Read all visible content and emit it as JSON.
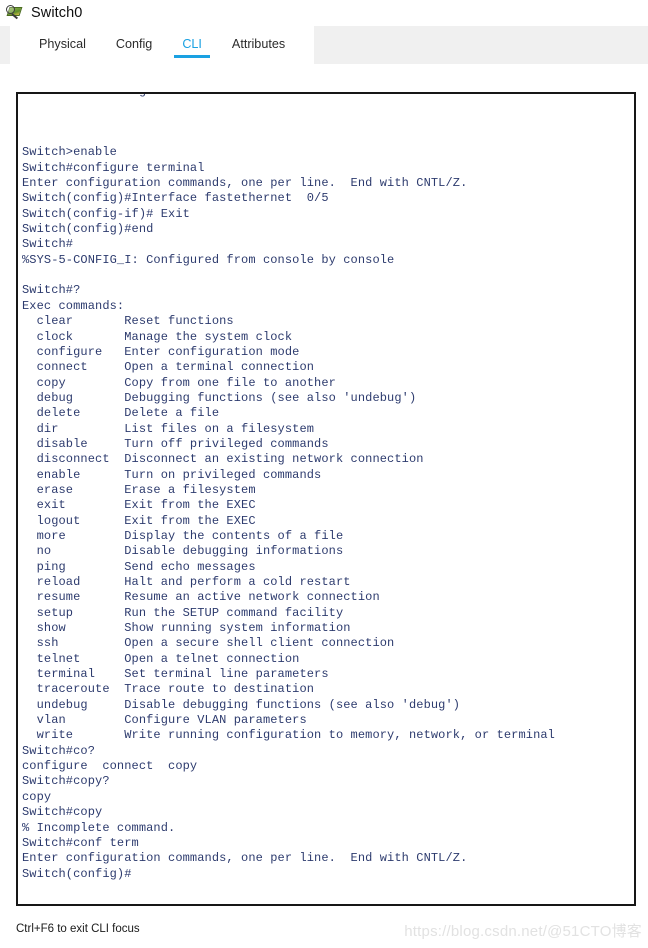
{
  "window": {
    "title": "Switch0",
    "icon": "switch-device-icon"
  },
  "tabs": [
    {
      "label": "Physical",
      "active": false
    },
    {
      "label": "Config",
      "active": false
    },
    {
      "label": "CLI",
      "active": true
    },
    {
      "label": "Attributes",
      "active": false
    }
  ],
  "colors": {
    "accent": "#1aa1e2",
    "terminal_text": "#2d3b6e",
    "terminal_border": "#171717",
    "tabstrip_bg": "#f0f0f0",
    "watermark": "#e2e2e2"
  },
  "terminal": {
    "lines": [
      "Press RETURN to get started!",
      "",
      "",
      "",
      "Switch>enable",
      "Switch#configure terminal",
      "Enter configuration commands, one per line.  End with CNTL/Z.",
      "Switch(config)#Interface fastethernet  0/5",
      "Switch(config-if)# Exit",
      "Switch(config)#end",
      "Switch#",
      "%SYS-5-CONFIG_I: Configured from console by console",
      "",
      "Switch#?",
      "Exec commands:",
      "  clear       Reset functions",
      "  clock       Manage the system clock",
      "  configure   Enter configuration mode",
      "  connect     Open a terminal connection",
      "  copy        Copy from one file to another",
      "  debug       Debugging functions (see also 'undebug')",
      "  delete      Delete a file",
      "  dir         List files on a filesystem",
      "  disable     Turn off privileged commands",
      "  disconnect  Disconnect an existing network connection",
      "  enable      Turn on privileged commands",
      "  erase       Erase a filesystem",
      "  exit        Exit from the EXEC",
      "  logout      Exit from the EXEC",
      "  more        Display the contents of a file",
      "  no          Disable debugging informations",
      "  ping        Send echo messages",
      "  reload      Halt and perform a cold restart",
      "  resume      Resume an active network connection",
      "  setup       Run the SETUP command facility",
      "  show        Show running system information",
      "  ssh         Open a secure shell client connection",
      "  telnet      Open a telnet connection",
      "  terminal    Set terminal line parameters",
      "  traceroute  Trace route to destination",
      "  undebug     Disable debugging functions (see also 'debug')",
      "  vlan        Configure VLAN parameters",
      "  write       Write running configuration to memory, network, or terminal",
      "Switch#co?",
      "configure  connect  copy",
      "Switch#copy?",
      "copy",
      "Switch#copy",
      "% Incomplete command.",
      "Switch#conf term",
      "Enter configuration commands, one per line.  End with CNTL/Z.",
      "Switch(config)#"
    ]
  },
  "footer": {
    "hint": "Ctrl+F6 to exit CLI focus",
    "watermark": "https://blog.csdn.net/@51CTO博客"
  }
}
